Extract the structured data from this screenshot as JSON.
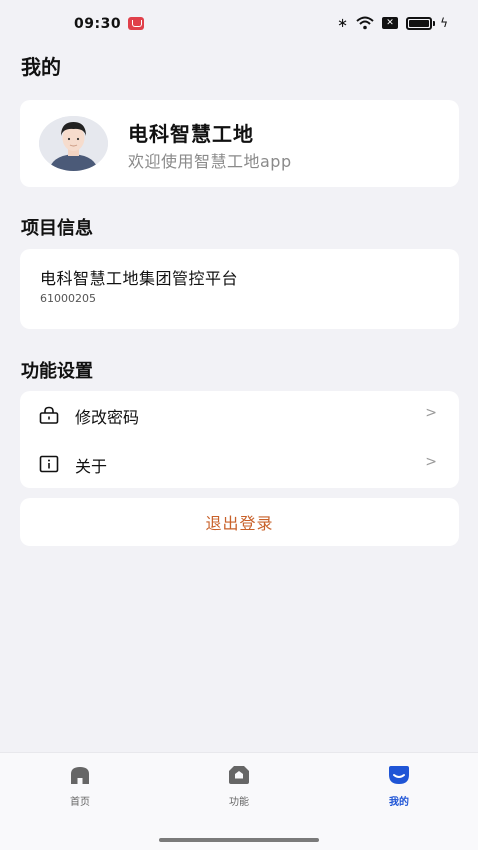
{
  "status_bar": {
    "time": "09:30"
  },
  "page_title": "我的",
  "profile": {
    "name": "电科智慧工地",
    "subtitle": "欢迎使用智慧工地app"
  },
  "project_section": {
    "title": "项目信息",
    "project_name": "电科智慧工地集团管控平台",
    "project_code": "61000205"
  },
  "settings_section": {
    "title": "功能设置",
    "items": [
      {
        "label": "修改密码",
        "icon": "lock-icon"
      },
      {
        "label": "关于",
        "icon": "info-icon"
      }
    ]
  },
  "logout_label": "退出登录",
  "tabs": [
    {
      "label": "首页",
      "icon": "home-icon",
      "active": false
    },
    {
      "label": "功能",
      "icon": "function-icon",
      "active": false
    },
    {
      "label": "我的",
      "icon": "profile-icon",
      "active": true
    }
  ],
  "colors": {
    "accent": "#1f55d6",
    "logout": "#c8612a",
    "background": "#f2f2f6"
  }
}
